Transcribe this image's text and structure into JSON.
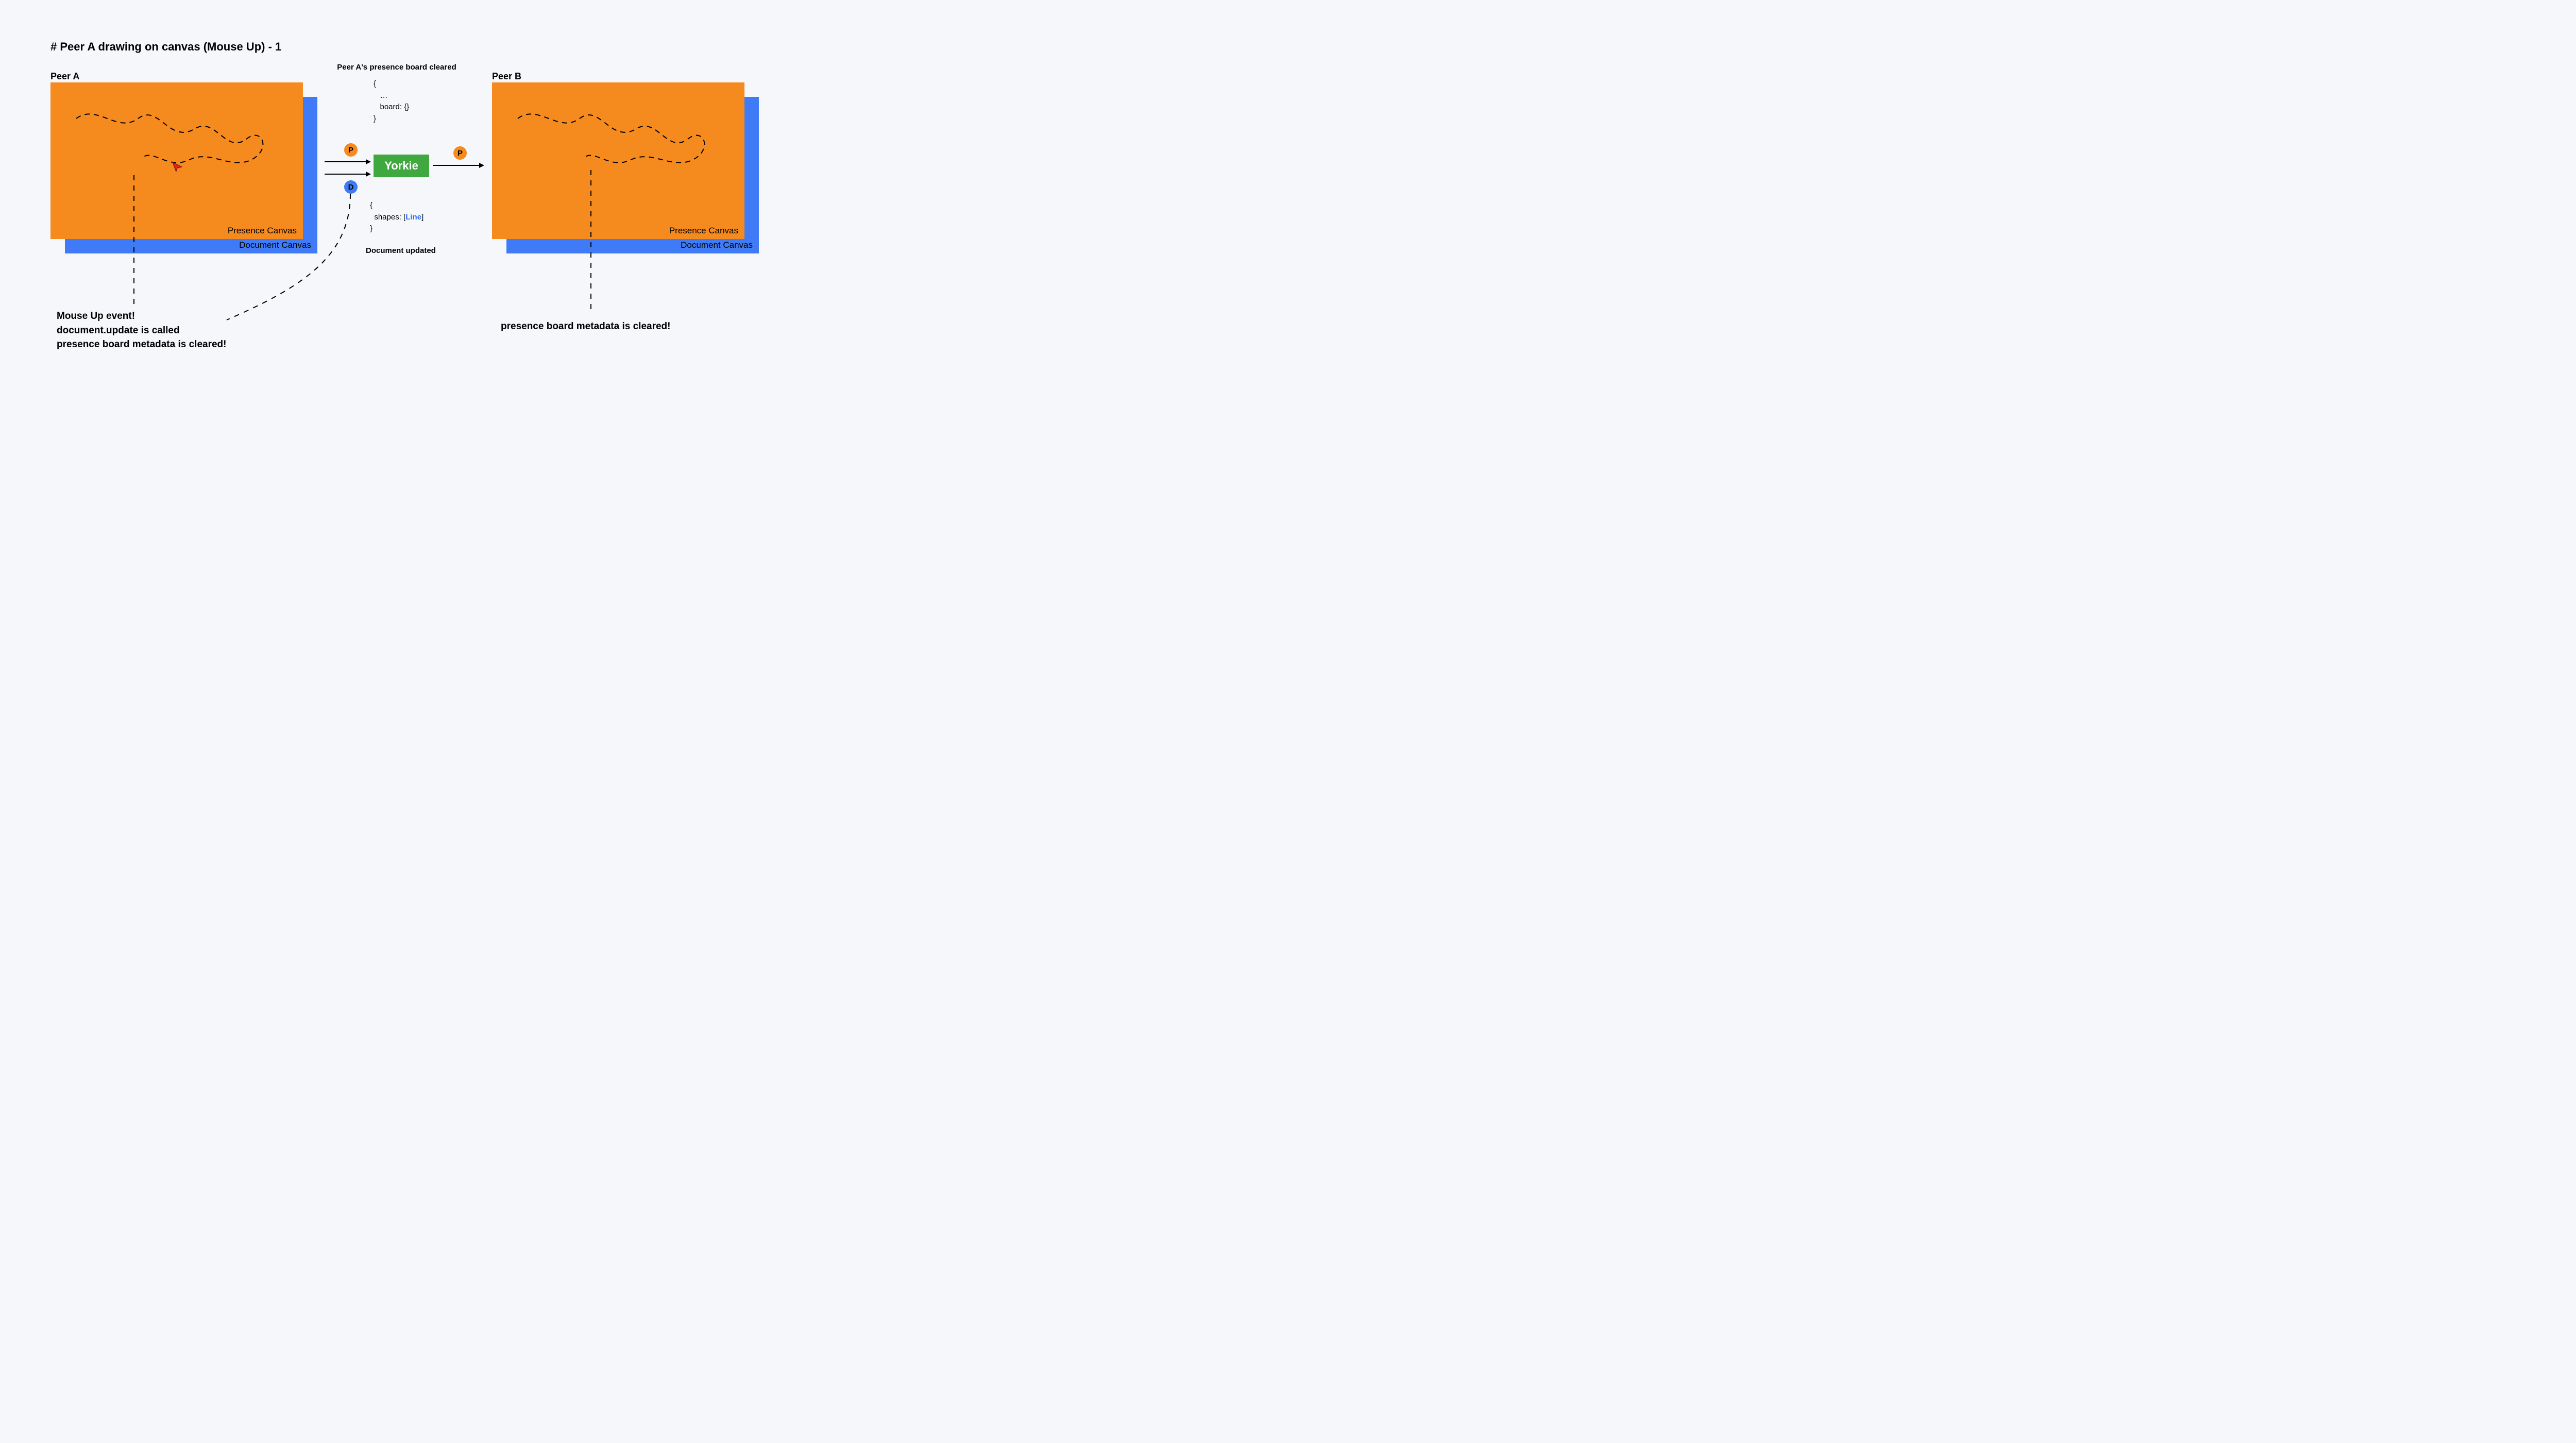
{
  "title": "# Peer A drawing on canvas (Mouse Up) - 1",
  "peerA": {
    "label": "Peer A",
    "presenceLabel": "Presence Canvas",
    "documentLabel": "Document Canvas",
    "noteLine1": "Mouse Up event!",
    "noteLine2": "document.update is called",
    "noteLine3": "presence board metadata is cleared!"
  },
  "peerB": {
    "label": "Peer B",
    "presenceLabel": "Presence Canvas",
    "documentLabel": "Document Canvas",
    "note": "presence board metadata is cleared!"
  },
  "server": {
    "name": "Yorkie",
    "presenceCaption": "Peer A's presence board cleared",
    "presenceCode": "{\n   …\n   board: {}\n}",
    "documentCaption": "Document updated",
    "documentCodePrefix": "{\n  shapes: [",
    "documentCodeLink": "Line",
    "documentCodeSuffix": "]\n}"
  },
  "badges": {
    "p": "P",
    "d": "D"
  },
  "colors": {
    "orange": "#f58a1f",
    "blue": "#407bf7",
    "green": "#3fa83f",
    "linkBlue": "#2a6ef5",
    "cursorRed": "#e2261d"
  }
}
